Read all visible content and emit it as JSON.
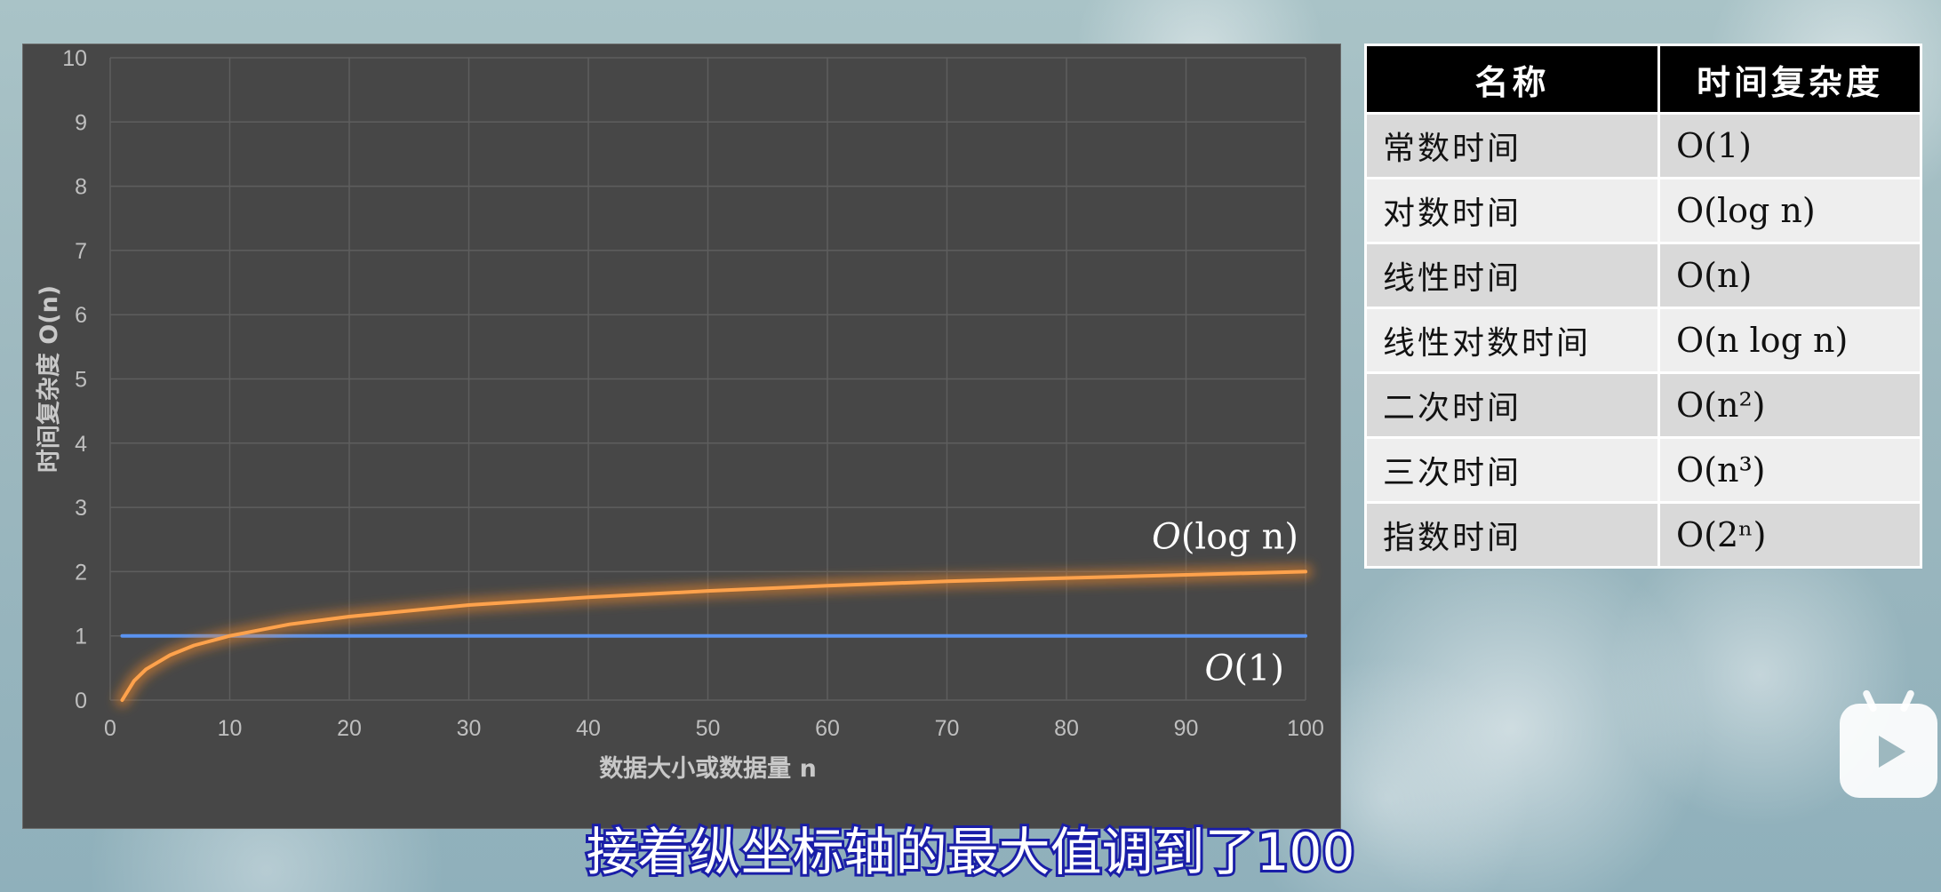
{
  "chart_data": {
    "type": "line",
    "xlabel": "数据大小或数据量 n",
    "ylabel": "时间复杂度 O(n)",
    "xlim": [
      0,
      100
    ],
    "ylim": [
      0,
      10
    ],
    "x_ticks": [
      0,
      10,
      20,
      30,
      40,
      50,
      60,
      70,
      80,
      90,
      100
    ],
    "y_ticks": [
      0,
      1,
      2,
      3,
      4,
      5,
      6,
      7,
      8,
      9,
      10
    ],
    "grid": true,
    "series": [
      {
        "name": "O(1)",
        "color": "#3d7be0",
        "x": [
          1,
          100
        ],
        "y": [
          1,
          1
        ]
      },
      {
        "name": "O(log n)",
        "color": "#f0862a",
        "x": [
          1,
          2,
          3,
          5,
          7,
          10,
          15,
          20,
          30,
          40,
          50,
          60,
          70,
          80,
          90,
          100
        ],
        "y": [
          0,
          0.3,
          0.48,
          0.7,
          0.85,
          1.0,
          1.18,
          1.3,
          1.48,
          1.6,
          1.7,
          1.78,
          1.85,
          1.9,
          1.95,
          2.0
        ]
      }
    ],
    "annotations": [
      {
        "text_fn": "O",
        "text_arg": "(log n)",
        "series": "O(log n)"
      },
      {
        "text_fn": "O",
        "text_arg": "(1)",
        "series": "O(1)"
      }
    ]
  },
  "table": {
    "headers": [
      "名称",
      "时间复杂度"
    ],
    "rows": [
      {
        "name": "常数时间",
        "complexity": "O(1)"
      },
      {
        "name": "对数时间",
        "complexity": "O(log n)"
      },
      {
        "name": "线性时间",
        "complexity": "O(n)"
      },
      {
        "name": "线性对数时间",
        "complexity": "O(n log n)"
      },
      {
        "name": "二次时间",
        "complexity": "O(n²)"
      },
      {
        "name": "三次时间",
        "complexity": "O(n³)"
      },
      {
        "name": "指数时间",
        "complexity": "O(2ⁿ)"
      }
    ]
  },
  "subtitle": "接着纵坐标轴的最大值调到了100",
  "logo": {
    "icon": "play-icon"
  }
}
